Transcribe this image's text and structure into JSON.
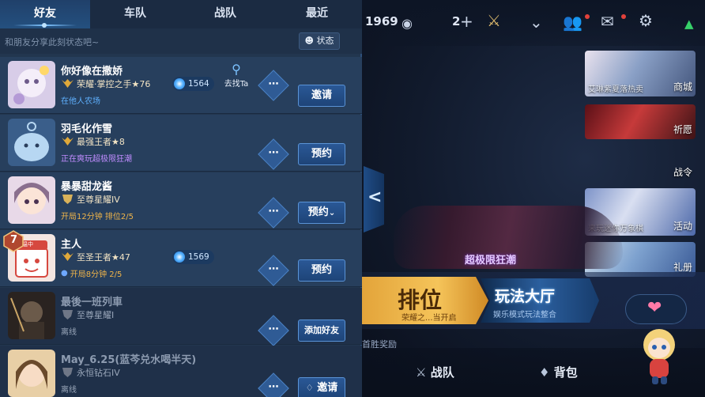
{
  "tabs": [
    {
      "label": "好友",
      "active": true
    },
    {
      "label": "车队",
      "active": false
    },
    {
      "label": "战队",
      "active": false
    },
    {
      "label": "最近",
      "active": false
    }
  ],
  "status_bar": {
    "placeholder": "和朋友分享此刻状态吧~",
    "button_label": "状态"
  },
  "friends": [
    {
      "name": "你好像在撒娇",
      "rank": "荣耀·掌控之手★76",
      "status": "在他人农场",
      "status_color": "#5fb1ff",
      "points": "1564",
      "location": "去找Ta",
      "action": "邀请",
      "online": true
    },
    {
      "name": "羽毛化作雪",
      "rank": "最强王者★8",
      "status": "正在爽玩超极限狂潮",
      "status_color": "#c08cff",
      "action": "预约",
      "online": true
    },
    {
      "name": "暴暴甜龙酱",
      "rank": "至尊星耀IV",
      "status": "开局12分钟 排位2/5",
      "status_color": "#f0b54a",
      "action": "预约",
      "online": true
    },
    {
      "name": "主人",
      "rank": "至圣王者★47",
      "status": "开局8分钟 2/5",
      "status_color": "#f0b54a",
      "points": "1569",
      "level": "7",
      "avatar_tag": "红温中",
      "action": "预约",
      "online": true
    },
    {
      "name": "最後一班列車",
      "rank": "至尊星耀I",
      "status": "离线",
      "status_color": "#9aa7ba",
      "action": "添加好友",
      "online": false
    },
    {
      "name": "May_6.25(蓝芩兑水喝半天)",
      "rank": "永恒钻石IV",
      "status": "离线",
      "status_color": "#9aa7ba",
      "action": "邀请",
      "online": false
    }
  ],
  "lobby": {
    "top_count": "1969",
    "friends_count": "2",
    "side_items": [
      {
        "label": "商城",
        "caption": "艾琳紫夏落热卖"
      },
      {
        "label": "祈愿",
        "caption": ""
      },
      {
        "label": "战令",
        "caption": ""
      },
      {
        "label": "活动",
        "caption": "来玩迷你万象棋"
      },
      {
        "label": "礼册",
        "caption": ""
      }
    ],
    "mode_tag": "超极限狂潮",
    "rank_button": "排位",
    "rank_sub": "荣耀之...当开启",
    "play_button": "玩法大厅",
    "play_sub": "娱乐模式玩法整合",
    "hint": "首胜奖励",
    "bottom_links": [
      "战队",
      "背包"
    ]
  }
}
